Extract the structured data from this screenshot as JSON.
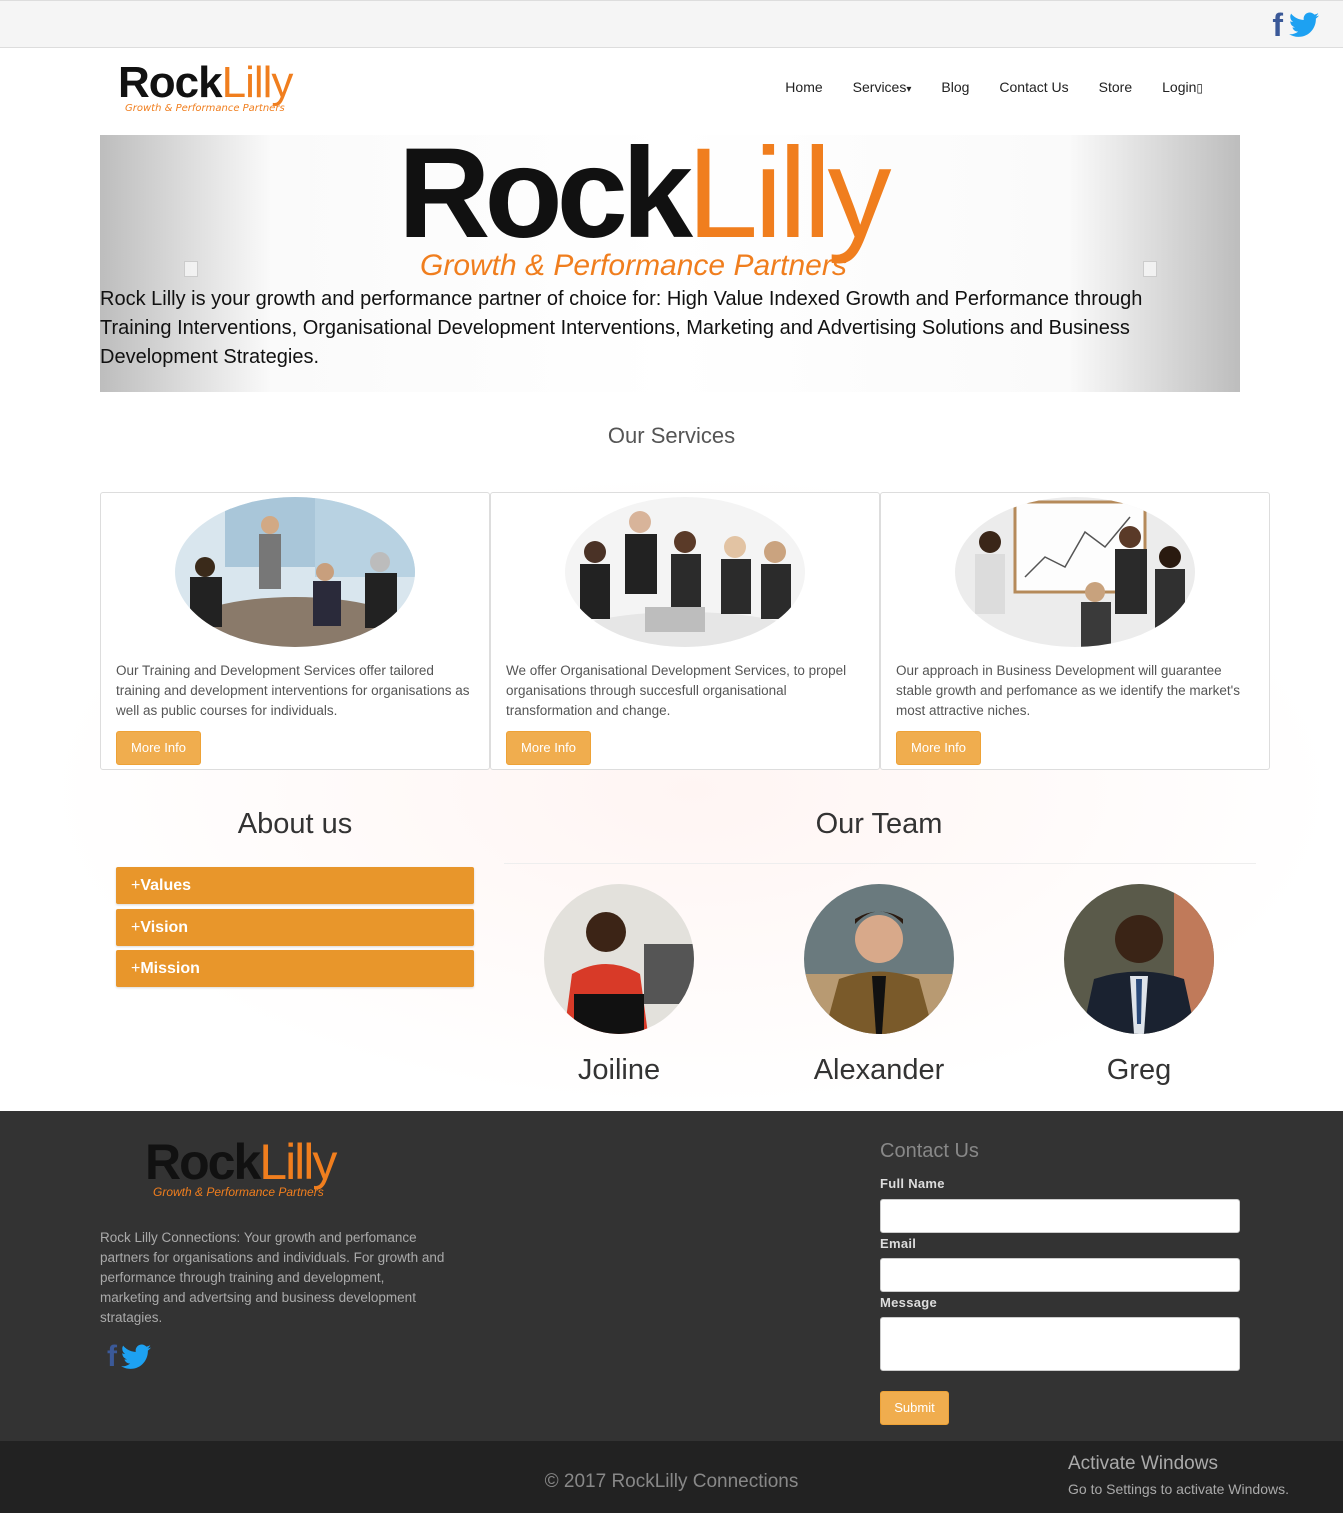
{
  "topbar": {
    "social": [
      "facebook-icon",
      "twitter-icon"
    ]
  },
  "brand": {
    "rock": "Rock",
    "lilly": "Lilly",
    "tagline": "Growth & Performance Partners"
  },
  "nav": {
    "home": "Home",
    "services": "Services",
    "services_caret": "▾",
    "blog": "Blog",
    "contact": "Contact Us",
    "store": "Store",
    "login": "Login",
    "login_glyph": "▯"
  },
  "hero": {
    "caption": "Rock Lilly is your growth and performance partner of choice for: High Value Indexed Growth and Performance through Training Interventions, Organisational Development Interventions, Marketing and Advertising Solutions and Business Development Strategies.",
    "prev_icon": "prev-arrow-icon",
    "next_icon": "next-arrow-icon"
  },
  "services": {
    "title": "Our Services",
    "cards": [
      {
        "text": "Our Training and Development Services offer tailored training and development interventions for organisations as well as public courses for individuals.",
        "button": "More Info"
      },
      {
        "text": "We offer Organisational Development Services, to propel organisations through succesfull organisational transformation and change.",
        "button": "More Info"
      },
      {
        "text": "Our approach in Business Development will guarantee stable growth and perfomance as we identify the market's most attractive niches.",
        "button": "More Info"
      }
    ]
  },
  "about": {
    "title": "About us",
    "items": [
      {
        "plus": "+",
        "label": "Values"
      },
      {
        "plus": "+",
        "label": "Vision"
      },
      {
        "plus": "+",
        "label": "Mission"
      }
    ]
  },
  "team": {
    "title": "Our Team",
    "members": [
      {
        "name": "Joiline"
      },
      {
        "name": "Alexander"
      },
      {
        "name": "Greg"
      }
    ]
  },
  "footer": {
    "about": "Rock Lilly Connections: Your growth and perfomance partners for organisations and individuals. For growth and performance through training and development, marketing and advertsing and business development stratagies.",
    "contact": {
      "title": "Contact Us",
      "full_name_label": "Full Name",
      "email_label": "Email",
      "message_label": "Message",
      "full_name_value": "",
      "email_value": "",
      "message_value": "",
      "submit": "Submit"
    },
    "copyright": "© 2017 RockLilly Connections"
  },
  "os_watermark": {
    "line1": "Activate Windows",
    "line2": "Go to Settings to activate Windows."
  },
  "colors": {
    "accent": "#f0ad4e",
    "accordion": "#e8962b",
    "brand_orange": "#f07e1e",
    "footer_bg": "#333333",
    "bottom_bg": "#222222"
  }
}
